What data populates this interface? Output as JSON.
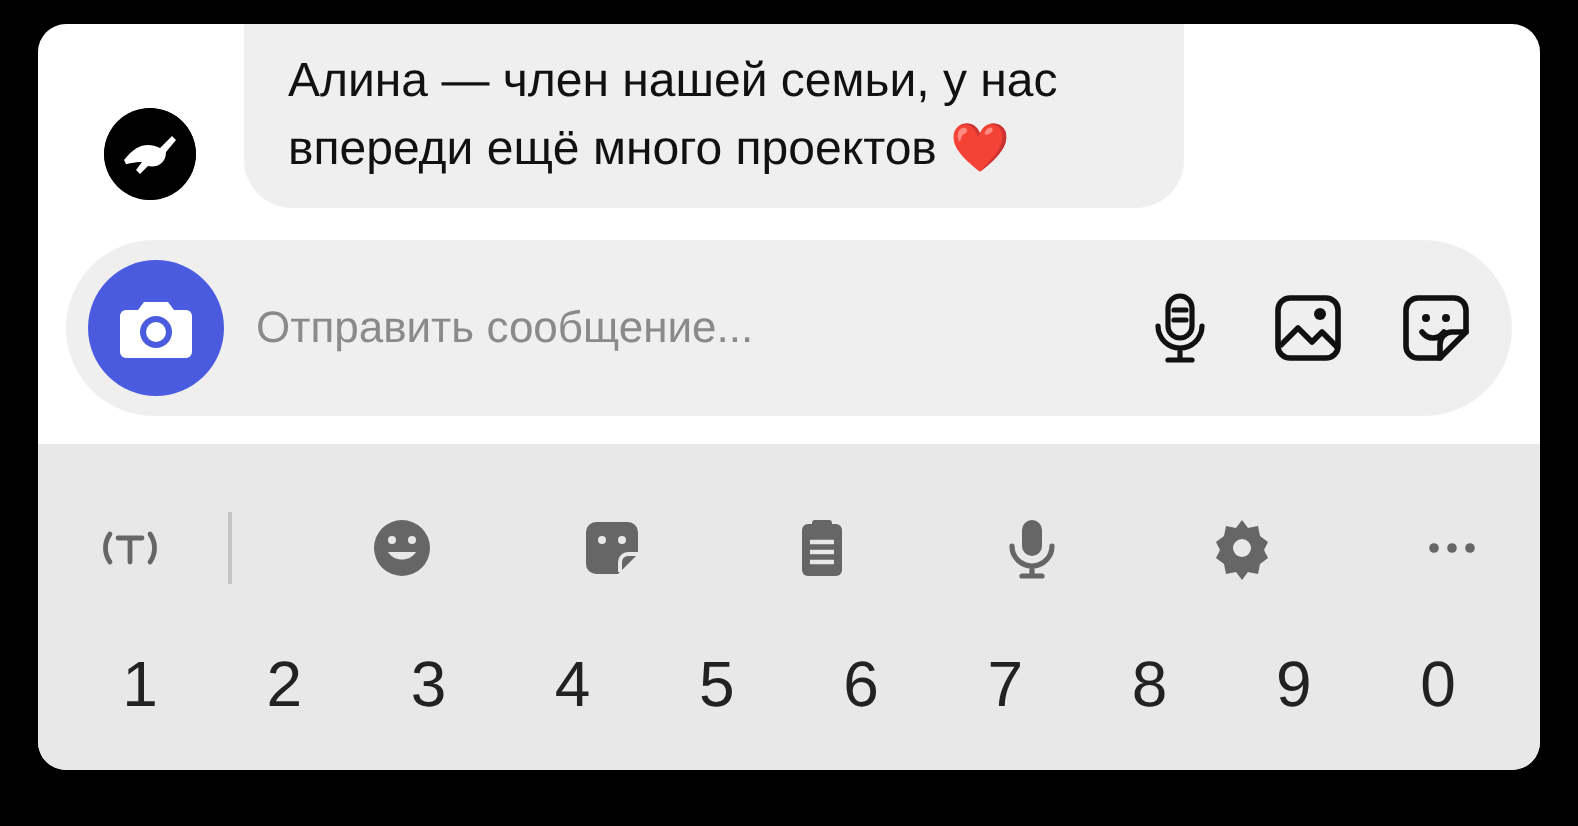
{
  "message": {
    "text": "Алина — член нашей семьи, у нас впереди ещё много проектов ❤️"
  },
  "composer": {
    "placeholder": "Отправить сообщение..."
  },
  "keyboard": {
    "number_keys": [
      "1",
      "2",
      "3",
      "4",
      "5",
      "6",
      "7",
      "8",
      "9",
      "0"
    ]
  }
}
